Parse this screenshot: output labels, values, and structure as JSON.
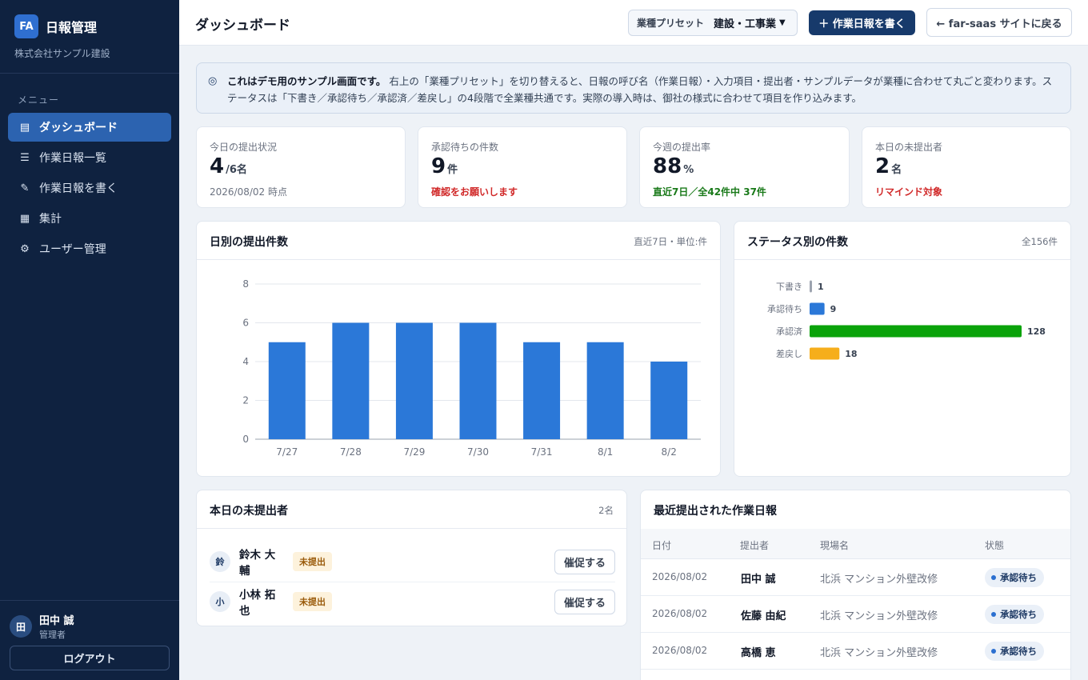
{
  "sidebar": {
    "logo": "FA",
    "app_title": "日報管理",
    "company": "株式会社サンプル建設",
    "menu_heading": "メニュー",
    "items": [
      {
        "icon": "▤",
        "label": "ダッシュボード",
        "active": true
      },
      {
        "icon": "☰",
        "label": "作業日報一覧"
      },
      {
        "icon": "✎",
        "label": "作業日報を書く"
      },
      {
        "icon": "▦",
        "label": "集計"
      },
      {
        "icon": "⚙",
        "label": "ユーザー管理"
      }
    ],
    "user": {
      "avatar": "田",
      "name": "田中 誠",
      "role": "管理者"
    },
    "logout_label": "ログアウト"
  },
  "header": {
    "title": "ダッシュボード",
    "preset_label": "業種プリセット",
    "preset_value": "建設・工事業",
    "write_button": "＋ 作業日報を書く",
    "back_button": "← far-saas サイトに戻る"
  },
  "notice": {
    "icon": "◎",
    "bold": "これはデモ用のサンプル画面です。",
    "text": "右上の「業種プリセット」を切り替えると、日報の呼び名（作業日報）・入力項目・提出者・サンプルデータが業種に合わせて丸ごと変わります。ステータスは「下書き／承認待ち／承認済／差戻し」の4段階で全業種共通です。実際の導入時は、御社の様式に合わせて項目を作り込みます。"
  },
  "stats": [
    {
      "label": "今日の提出状況",
      "value": "4",
      "unit": "/6名",
      "sub": "2026/08/02 時点"
    },
    {
      "label": "承認待ちの件数",
      "value": "9",
      "unit": "件",
      "sub": "確認をお願いします"
    },
    {
      "label": "今週の提出率",
      "value": "88",
      "unit": "%",
      "sub": "直近7日／全42件中 37件"
    },
    {
      "label": "本日の未提出者",
      "value": "2",
      "unit": "名",
      "sub": "リマインド対象"
    }
  ],
  "daily_panel": {
    "title": "日別の提出件数",
    "meta": "直近7日・単位:件"
  },
  "status_panel": {
    "title": "ステータス別の件数",
    "meta": "全156件"
  },
  "chart_data": [
    {
      "type": "bar",
      "categories": [
        "7/27",
        "7/28",
        "7/29",
        "7/30",
        "7/31",
        "8/1",
        "8/2"
      ],
      "values": [
        5,
        6,
        6,
        6,
        5,
        5,
        4
      ],
      "ylim": [
        0,
        8
      ],
      "yticks": [
        0,
        2,
        4,
        6,
        8
      ],
      "grid": true,
      "color": "#2b78d8"
    },
    {
      "type": "bar",
      "orientation": "horizontal",
      "categories": [
        "下書き",
        "承認待ち",
        "承認済",
        "差戻し"
      ],
      "values": [
        1,
        9,
        128,
        18
      ],
      "colors": [
        "#9ca3af",
        "#2b78d8",
        "#0aa30a",
        "#f6ae1b"
      ]
    }
  ],
  "missing_panel": {
    "title": "本日の未提出者",
    "meta": "2名",
    "rows": [
      {
        "avatar": "鈴",
        "name": "鈴木 大輔",
        "badge": "未提出",
        "button": "催促する"
      },
      {
        "avatar": "小",
        "name": "小林 拓也",
        "badge": "未提出",
        "button": "催促する"
      }
    ]
  },
  "recent_panel": {
    "title": "最近提出された作業日報",
    "columns": [
      "日付",
      "提出者",
      "現場名",
      "状態"
    ],
    "rows": [
      {
        "date": "2026/08/02",
        "name": "田中 誠",
        "site": "北浜 マンション外壁改修",
        "status": "承認待ち"
      },
      {
        "date": "2026/08/02",
        "name": "佐藤 由紀",
        "site": "北浜 マンション外壁改修",
        "status": "承認待ち"
      },
      {
        "date": "2026/08/02",
        "name": "高橋 恵",
        "site": "北浜 マンション外壁改修",
        "status": "承認待ち"
      }
    ]
  }
}
